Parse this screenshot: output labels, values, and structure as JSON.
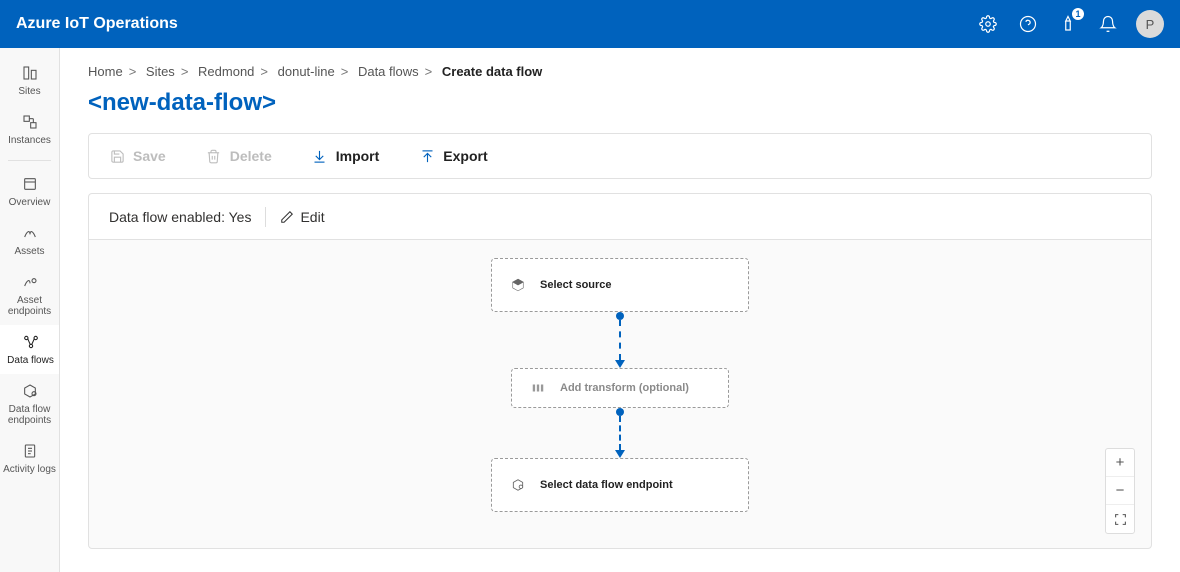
{
  "app": {
    "title": "Azure IoT Operations"
  },
  "header": {
    "settings_icon": "settings",
    "help_icon": "help",
    "feedback_icon": "feedback",
    "feedback_badge": "1",
    "notifications_icon": "notifications",
    "avatar_initial": "P"
  },
  "sidebar": {
    "items": [
      {
        "id": "sites",
        "label": "Sites"
      },
      {
        "id": "instances",
        "label": "Instances"
      },
      {
        "id": "overview",
        "label": "Overview"
      },
      {
        "id": "assets",
        "label": "Assets"
      },
      {
        "id": "asset-endpoints",
        "label": "Asset endpoints"
      },
      {
        "id": "data-flows",
        "label": "Data flows",
        "active": true
      },
      {
        "id": "data-flow-endpoints",
        "label": "Data flow endpoints"
      },
      {
        "id": "activity-logs",
        "label": "Activity logs"
      }
    ]
  },
  "breadcrumb": {
    "parts": [
      "Home",
      "Sites",
      "Redmond",
      "donut-line",
      "Data flows"
    ],
    "current": "Create data flow"
  },
  "page": {
    "title": "<new-data-flow>"
  },
  "toolbar": {
    "save": "Save",
    "delete": "Delete",
    "import": "Import",
    "export": "Export"
  },
  "status": {
    "label": "Data flow enabled: ",
    "value": "Yes",
    "edit": "Edit"
  },
  "flow": {
    "source_label": "Select source",
    "transform_label": "Add transform (optional)",
    "endpoint_label": "Select data flow endpoint"
  },
  "zoom": {
    "in": "+",
    "out": "−",
    "fit": "fit"
  }
}
